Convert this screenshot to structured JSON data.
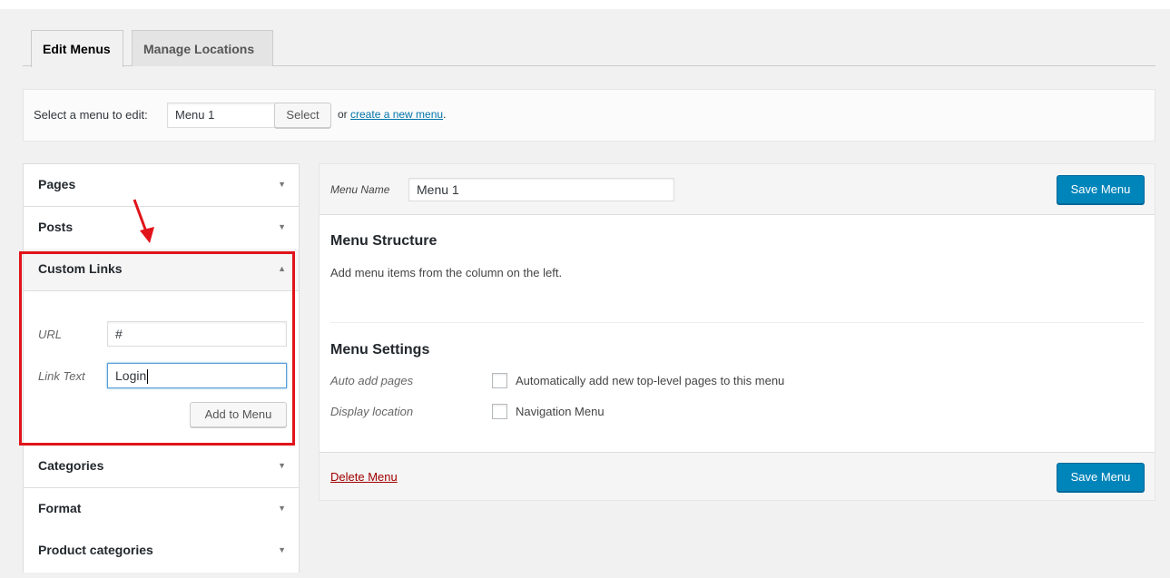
{
  "tabs": [
    {
      "label": "Edit Menus",
      "active": true
    },
    {
      "label": "Manage Locations",
      "active": false
    }
  ],
  "select_bar": {
    "label": "Select a menu to edit:",
    "selected_menu": "Menu 1",
    "select_button": "Select",
    "or_text": "or",
    "create_link": "create a new menu",
    "period": "."
  },
  "accordion": {
    "pages": "Pages",
    "posts": "Posts",
    "custom_links": "Custom Links",
    "categories": "Categories",
    "format": "Format",
    "product_categories": "Product categories"
  },
  "custom_links": {
    "url_label": "URL",
    "url_value": "#",
    "link_text_label": "Link Text",
    "link_text_value": "Login",
    "add_button": "Add to Menu"
  },
  "menu_panel": {
    "name_label": "Menu Name",
    "name_value": "Menu 1",
    "save_button": "Save Menu",
    "structure_title": "Menu Structure",
    "structure_desc": "Add menu items from the column on the left.",
    "settings_title": "Menu Settings",
    "auto_add_label": "Auto add pages",
    "auto_add_option": "Automatically add new top-level pages to this menu",
    "display_label": "Display location",
    "display_option": "Navigation Menu",
    "delete_link": "Delete Menu"
  },
  "icons": {
    "collapsed": "arrow-down-icon",
    "expanded": "arrow-up-icon",
    "annotation": "red-arrow-icon"
  },
  "colors": {
    "primary_button": "#0085ba",
    "link": "#0073aa",
    "delete": "#a00000",
    "highlight": "#e0141a"
  }
}
